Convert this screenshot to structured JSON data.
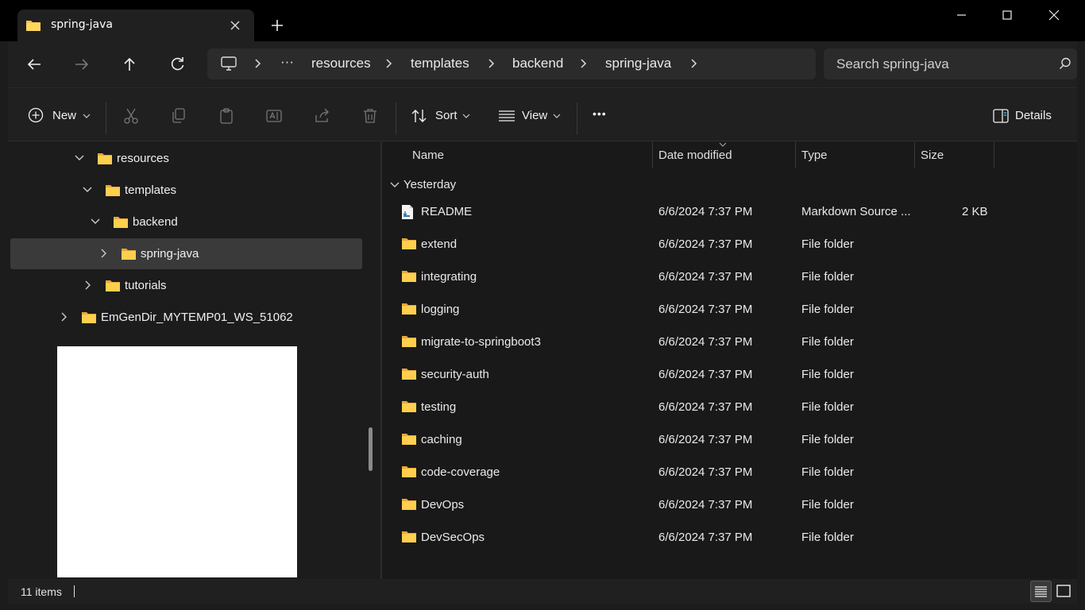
{
  "tab": {
    "title": "spring-java"
  },
  "breadcrumb": {
    "overflow": "···",
    "items": [
      "resources",
      "templates",
      "backend",
      "spring-java"
    ]
  },
  "search": {
    "placeholder": "Search spring-java"
  },
  "toolbar": {
    "new_label": "New",
    "sort_label": "Sort",
    "view_label": "View",
    "more_label": "•••",
    "details_label": "Details"
  },
  "nav": {
    "items": [
      {
        "label": "resources",
        "expanded": true
      },
      {
        "label": "templates",
        "expanded": true
      },
      {
        "label": "backend",
        "expanded": true
      },
      {
        "label": "spring-java",
        "expanded": false,
        "selected": true
      },
      {
        "label": "tutorials",
        "expanded": false
      },
      {
        "label": "EmGenDir_MYTEMP01_WS_51062",
        "expanded": false
      }
    ]
  },
  "columns": {
    "name": "Name",
    "date": "Date modified",
    "type": "Type",
    "size": "Size"
  },
  "group": {
    "label": "Yesterday"
  },
  "files": [
    {
      "name": "README",
      "date": "6/6/2024 7:37 PM",
      "type": "Markdown Source ...",
      "size": "2 KB",
      "icon": "markdown-file-icon"
    },
    {
      "name": "extend",
      "date": "6/6/2024 7:37 PM",
      "type": "File folder",
      "size": "",
      "icon": "folder-icon"
    },
    {
      "name": "integrating",
      "date": "6/6/2024 7:37 PM",
      "type": "File folder",
      "size": "",
      "icon": "folder-icon"
    },
    {
      "name": "logging",
      "date": "6/6/2024 7:37 PM",
      "type": "File folder",
      "size": "",
      "icon": "folder-icon"
    },
    {
      "name": "migrate-to-springboot3",
      "date": "6/6/2024 7:37 PM",
      "type": "File folder",
      "size": "",
      "icon": "folder-icon"
    },
    {
      "name": "security-auth",
      "date": "6/6/2024 7:37 PM",
      "type": "File folder",
      "size": "",
      "icon": "folder-icon"
    },
    {
      "name": "testing",
      "date": "6/6/2024 7:37 PM",
      "type": "File folder",
      "size": "",
      "icon": "folder-icon"
    },
    {
      "name": "caching",
      "date": "6/6/2024 7:37 PM",
      "type": "File folder",
      "size": "",
      "icon": "folder-icon"
    },
    {
      "name": "code-coverage",
      "date": "6/6/2024 7:37 PM",
      "type": "File folder",
      "size": "",
      "icon": "folder-icon"
    },
    {
      "name": "DevOps",
      "date": "6/6/2024 7:37 PM",
      "type": "File folder",
      "size": "",
      "icon": "folder-icon"
    },
    {
      "name": "DevSecOps",
      "date": "6/6/2024 7:37 PM",
      "type": "File folder",
      "size": "",
      "icon": "folder-icon"
    }
  ],
  "status": {
    "item_count": "11 items"
  },
  "colors": {
    "folder": "#f8c34d",
    "accent": "#4cc2ff",
    "background": "#191919"
  }
}
